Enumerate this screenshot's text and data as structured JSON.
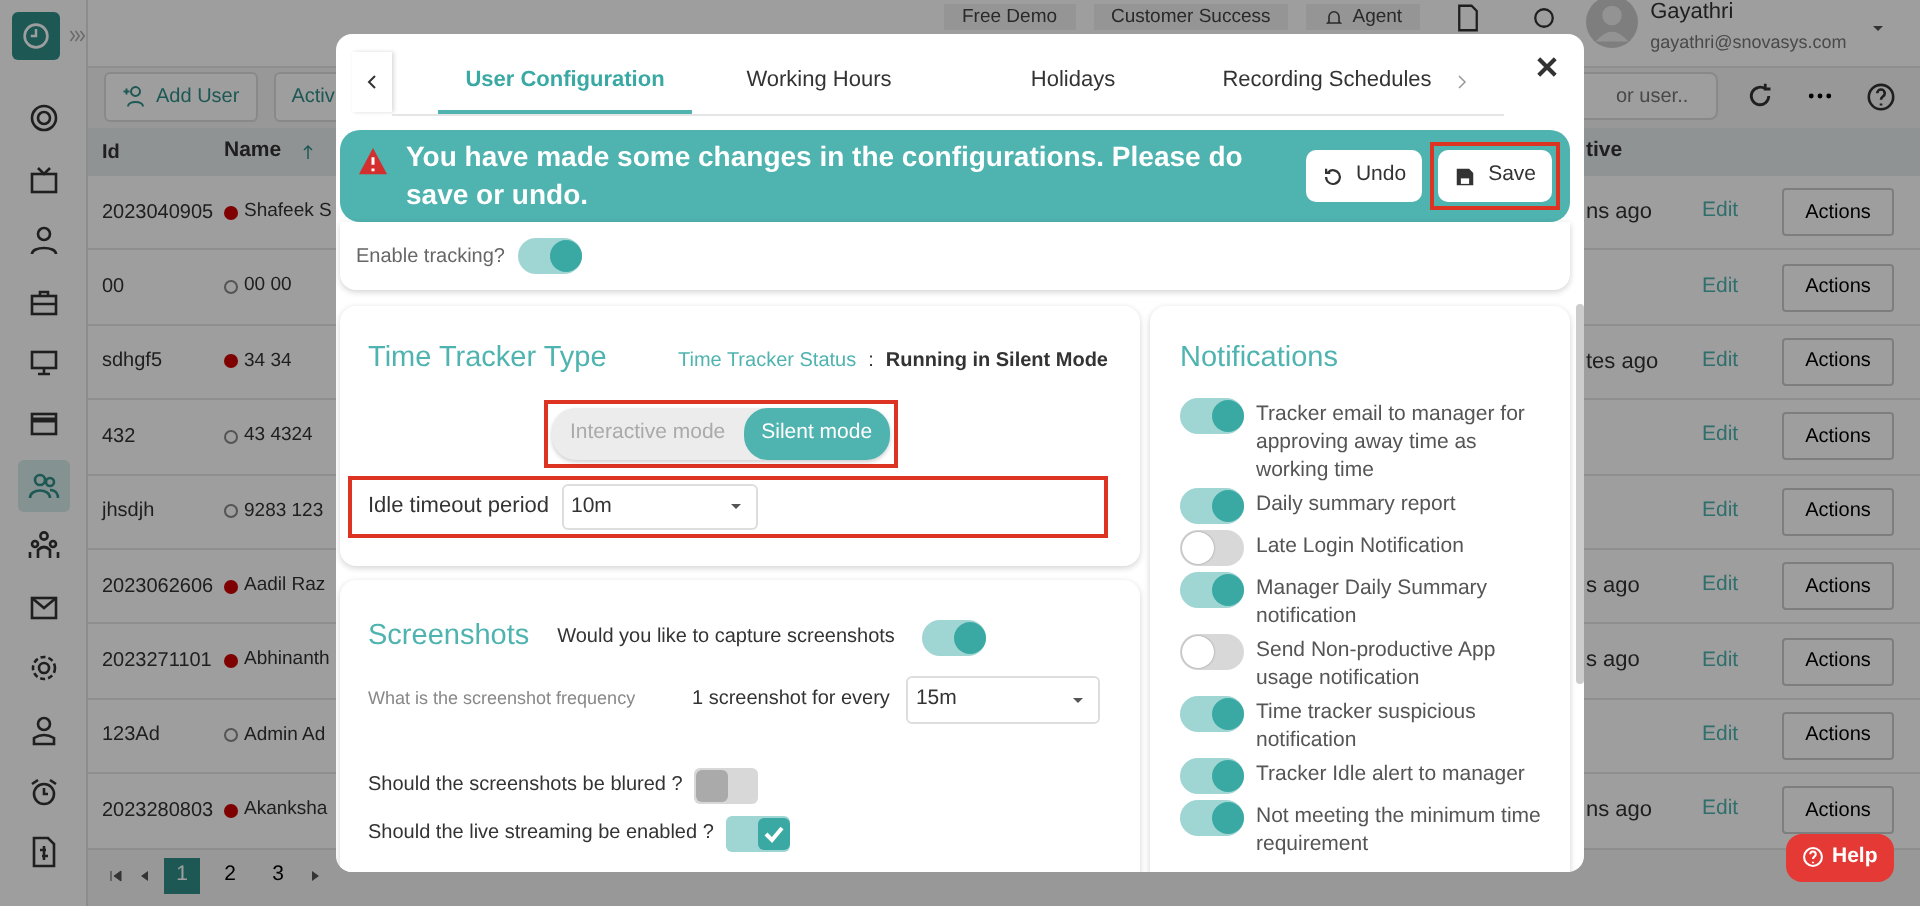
{
  "app": {
    "header_buttons": [
      {
        "label": "Free Demo"
      },
      {
        "label": "Customer Success"
      },
      {
        "label": "Agent"
      }
    ],
    "user": {
      "name": "Gayathri",
      "email": "gayathri@snovasys.com"
    },
    "sidebar": [
      {
        "selected": false
      },
      {
        "selected": false
      },
      {
        "selected": false
      },
      {
        "selected": false
      },
      {
        "selected": false
      },
      {
        "selected": false
      },
      {
        "selected": true
      },
      {
        "selected": false
      },
      {
        "selected": false
      },
      {
        "selected": false
      },
      {
        "selected": false
      },
      {
        "selected": false
      },
      {
        "selected": false
      }
    ],
    "toolbar": {
      "add_user": "Add User",
      "filter": "Activ",
      "search_placeholder": "or user.."
    },
    "table": {
      "columns": [
        "Id",
        "Name",
        "tive"
      ],
      "rows": [
        {
          "id": "2023040905",
          "online": true,
          "name": "Shafeek S",
          "last_active": "ns ago",
          "edit": "Edit",
          "action": "Actions"
        },
        {
          "id": "00",
          "online": false,
          "name": "00 00",
          "edit": "Edit",
          "action": "Actions"
        },
        {
          "id": "sdhgf5",
          "online": true,
          "name": "34 34",
          "last_active": "tes ago",
          "edit": "Edit",
          "action": "Actions"
        },
        {
          "id": "432",
          "online": false,
          "name": "43 4324",
          "edit": "Edit",
          "action": "Actions"
        },
        {
          "id": "jhsdjh",
          "online": false,
          "name": "9283 123",
          "edit": "Edit",
          "action": "Actions"
        },
        {
          "id": "2023062606",
          "online": true,
          "name": "Aadil Raz",
          "last_active": "s ago",
          "edit": "Edit",
          "action": "Actions"
        },
        {
          "id": "2023271101",
          "online": true,
          "name": "Abhinanth",
          "last_active": "s ago",
          "edit": "Edit",
          "action": "Actions"
        },
        {
          "id": "123Ad",
          "online": false,
          "name": "Admin Ad",
          "edit": "Edit",
          "action": "Actions"
        },
        {
          "id": "2023280803",
          "online": true,
          "name": "Akanksha",
          "last_active": "ns ago",
          "edit": "Edit",
          "action": "Actions"
        }
      ]
    },
    "pagination": [
      {
        "label": "1",
        "selected": true
      },
      {
        "label": "2",
        "selected": false
      },
      {
        "label": "3",
        "selected": false
      }
    ],
    "help": "Help"
  },
  "modal": {
    "tabs": [
      {
        "label": "User Configuration",
        "selected": true
      },
      {
        "label": "Working Hours",
        "selected": false
      },
      {
        "label": "Holidays",
        "selected": false
      },
      {
        "label": "Recording Schedules",
        "selected": false
      }
    ],
    "banner": {
      "message": "You have made some changes in the configurations. Please do save or undo.",
      "undo": "Undo",
      "save": {
        "label": "Save",
        "highlighted": true
      }
    },
    "enable_tracking": {
      "label": "Enable tracking?",
      "on": true
    },
    "time_tracker": {
      "title": "Time Tracker Type",
      "status_label": "Time Tracker Status",
      "separator": ":",
      "status_value": "Running in Silent Mode",
      "modes": [
        {
          "label": "Interactive mode",
          "selected": false
        },
        {
          "label": "Silent mode",
          "selected": true
        }
      ],
      "modes_highlighted": true,
      "idle": {
        "label": "Idle timeout period",
        "value": "10m",
        "highlighted": true
      }
    },
    "screenshots": {
      "title": "Screenshots",
      "capture": {
        "label": "Would you like to capture screenshots",
        "on": true
      },
      "frequency": {
        "label": "What is the screenshot frequency",
        "prefix": "1 screenshot for every",
        "value": "15m"
      },
      "options": [
        {
          "kind": "switch",
          "label": "Should the screenshots be blured ?",
          "on": false
        },
        {
          "kind": "check",
          "label": "Should the live streaming be enabled ?",
          "on": true
        }
      ]
    },
    "notifications": {
      "title": "Notifications",
      "items": [
        {
          "label": "Tracker email to manager for approving away time as working time",
          "on": true
        },
        {
          "label": "Daily summary report",
          "on": true
        },
        {
          "label": "Late Login Notification",
          "on": false
        },
        {
          "label": "Manager Daily Summary notification",
          "on": true
        },
        {
          "label": "Send Non-productive App usage notification",
          "on": false
        },
        {
          "label": "Time tracker suspicious notification",
          "on": true
        },
        {
          "label": "Tracker Idle alert to manager",
          "on": true
        },
        {
          "label": "Not meeting the minimum time requirement",
          "on": true
        }
      ]
    }
  }
}
